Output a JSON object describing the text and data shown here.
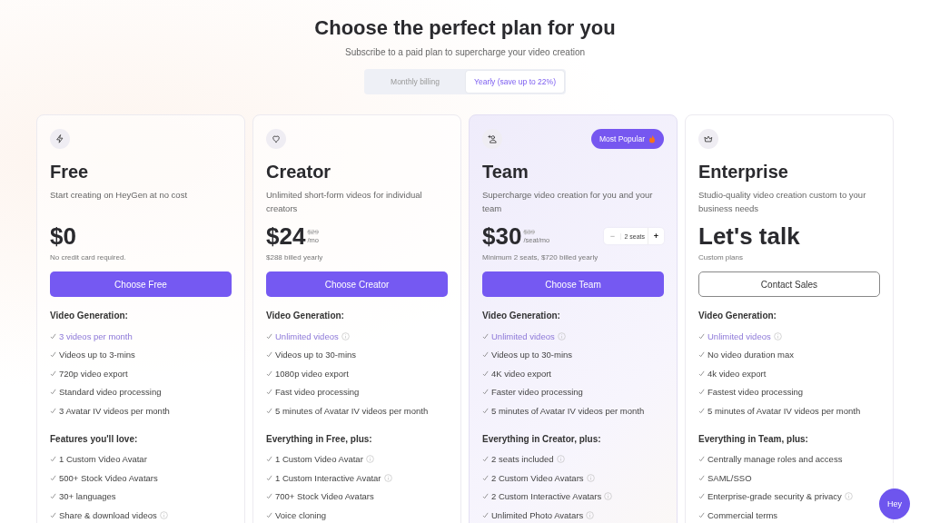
{
  "header": {
    "title": "Choose the perfect plan for you",
    "subtitle": "Subscribe to a paid plan to supercharge your video creation"
  },
  "billing": [
    {
      "label": "Monthly billing",
      "selected": false
    },
    {
      "label": "Yearly (save up to 22%)",
      "selected": true
    }
  ],
  "plans": [
    {
      "name": "Free",
      "featured": false,
      "description": "Start creating on HeyGen at no cost",
      "price": "$0",
      "note": "No credit card required.",
      "button": {
        "label": "Choose Free",
        "kind": "primary"
      },
      "sections": [
        {
          "heading": "Video Generation:",
          "items": [
            {
              "text": "3 videos per month",
              "highlight": true,
              "info": false
            },
            {
              "text": "Videos up to 3-mins",
              "highlight": false,
              "info": false
            },
            {
              "text": "720p video export",
              "highlight": false,
              "info": false
            },
            {
              "text": "Standard video processing",
              "highlight": false,
              "info": false
            },
            {
              "text": "3 Avatar IV videos per month",
              "highlight": false,
              "info": false
            }
          ]
        },
        {
          "heading": "Features you'll love:",
          "items": [
            {
              "text": "1 Custom Video Avatar",
              "highlight": false,
              "info": false
            },
            {
              "text": "500+ Stock Video Avatars",
              "highlight": false,
              "info": false
            },
            {
              "text": "30+ languages",
              "highlight": false,
              "info": false
            },
            {
              "text": "Share & download videos",
              "highlight": false,
              "info": true
            }
          ]
        }
      ]
    },
    {
      "name": "Creator",
      "featured": false,
      "description": "Unlimited short-form videos for individual creators",
      "price": "$24",
      "old_price": "$29",
      "unit": "/mo",
      "note": "$288 billed yearly",
      "button": {
        "label": "Choose Creator",
        "kind": "primary"
      },
      "sections": [
        {
          "heading": "Video Generation:",
          "items": [
            {
              "text": "Unlimited videos",
              "highlight": true,
              "info": true
            },
            {
              "text": "Videos up to 30-mins",
              "highlight": false,
              "info": false
            },
            {
              "text": "1080p video export",
              "highlight": false,
              "info": false
            },
            {
              "text": "Fast video processing",
              "highlight": false,
              "info": false
            },
            {
              "text": "5 minutes of Avatar IV videos per month",
              "highlight": false,
              "info": false
            }
          ]
        },
        {
          "heading": "Everything in Free, plus:",
          "items": [
            {
              "text": "1 Custom Video Avatar",
              "highlight": false,
              "info": true
            },
            {
              "text": "1 Custom Interactive Avatar",
              "highlight": false,
              "info": true
            },
            {
              "text": "700+ Stock Video Avatars",
              "highlight": false,
              "info": false
            },
            {
              "text": "Voice cloning",
              "highlight": false,
              "info": false
            }
          ]
        }
      ]
    },
    {
      "name": "Team",
      "featured": true,
      "badge": "Most Popular",
      "description": "Supercharge video creation for you and your team",
      "price": "$30",
      "old_price": "$39",
      "unit": "/seat/mo",
      "seats": {
        "minus": "−",
        "value": "2 seats",
        "plus": "+"
      },
      "note": "Minimum 2 seats, $720 billed yearly",
      "button": {
        "label": "Choose Team",
        "kind": "primary"
      },
      "sections": [
        {
          "heading": "Video Generation:",
          "items": [
            {
              "text": "Unlimited videos",
              "highlight": true,
              "info": true
            },
            {
              "text": "Videos up to 30-mins",
              "highlight": false,
              "info": false
            },
            {
              "text": "4K video export",
              "highlight": false,
              "info": false
            },
            {
              "text": "Faster video processing",
              "highlight": false,
              "info": false
            },
            {
              "text": "5 minutes of Avatar IV videos per month",
              "highlight": false,
              "info": false
            }
          ]
        },
        {
          "heading": "Everything in Creator, plus:",
          "items": [
            {
              "text": "2 seats included",
              "highlight": false,
              "info": true
            },
            {
              "text": "2 Custom Video Avatars",
              "highlight": false,
              "info": true
            },
            {
              "text": "2 Custom Interactive Avatars",
              "highlight": false,
              "info": true
            },
            {
              "text": "Unlimited Photo Avatars",
              "highlight": false,
              "info": true
            }
          ]
        }
      ]
    },
    {
      "name": "Enterprise",
      "featured": false,
      "description": "Studio-quality video creation custom to your business needs",
      "price": "Let's talk",
      "note": "Custom plans",
      "button": {
        "label": "Contact Sales",
        "kind": "outline"
      },
      "sections": [
        {
          "heading": "Video Generation:",
          "items": [
            {
              "text": "Unlimited videos",
              "highlight": true,
              "info": true
            },
            {
              "text": "No video duration max",
              "highlight": false,
              "info": false
            },
            {
              "text": "4k video export",
              "highlight": false,
              "info": false
            },
            {
              "text": "Fastest video processing",
              "highlight": false,
              "info": false
            },
            {
              "text": "5 minutes of Avatar IV videos per month",
              "highlight": false,
              "info": false
            }
          ]
        },
        {
          "heading": "Everything in Team, plus:",
          "items": [
            {
              "text": "Centrally manage roles and access",
              "highlight": false,
              "info": false
            },
            {
              "text": "SAML/SSO",
              "highlight": false,
              "info": false
            },
            {
              "text": "Enterprise-grade security & privacy",
              "highlight": false,
              "info": true
            },
            {
              "text": "Commercial terms",
              "highlight": false,
              "info": false
            }
          ]
        }
      ]
    }
  ],
  "chat_button": "Hey"
}
